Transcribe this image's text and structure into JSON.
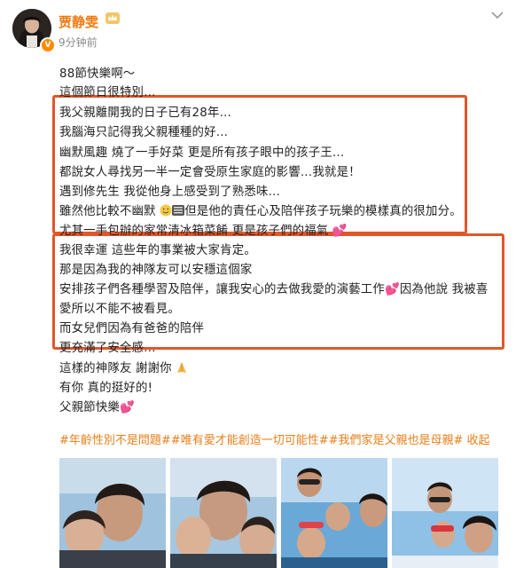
{
  "author": {
    "name": "贾静雯",
    "time": "9分钟前",
    "verified_badge": "V"
  },
  "post": {
    "lines": [
      "88節快樂啊～",
      "這個節日很特別…",
      "我父親離開我的日子已有28年…",
      "我腦海只記得我父親種種的好…",
      "幽默風趣 燒了一手好菜 更是所有孩子眼中的孩子王…",
      "都說女人尋找另一半一定會受原生家庭的影響…我就是！",
      "遇到修先生 我從他身上感受到了熟悉味…",
      "雖然他比較不幽默",
      "但是他的責任心及陪伴孩子玩樂的模樣真的很加分。",
      "尤其一手包辦的家常清冰箱菜餚 更是孩子們的福氣",
      "我很幸運 這些年的事業被大家肯定。",
      "那是因為我的神隊友可以安穩這個家",
      "安排孩子們各種學習及陪伴，讓我安心的去做我愛的演藝工作",
      "因為他說 我被喜",
      "愛所以不能不被看見。",
      "而女兒們因為有爸爸的陪伴",
      "更充滿了安全感…",
      "這樣的神隊友 謝謝你",
      "有你 真的挺好的!",
      "父親節快樂"
    ]
  },
  "tags": {
    "tag1": "#年齡性別不是問題#",
    "tag2": "#唯有愛才能創造一切可能性#",
    "tag3": "#我們家是父親也是母親#",
    "collapse": "收起"
  },
  "icons": {
    "more": "chevron-down-icon",
    "crown": "crown-icon",
    "heart": "heart-emoji",
    "praying": "praying-hands-emoji",
    "smile": "smile-emoji"
  },
  "colors": {
    "name": "#f07a12",
    "highlight_box": "#e0572a",
    "tag": "#e87f1a",
    "heart": "#ef4f7a"
  }
}
